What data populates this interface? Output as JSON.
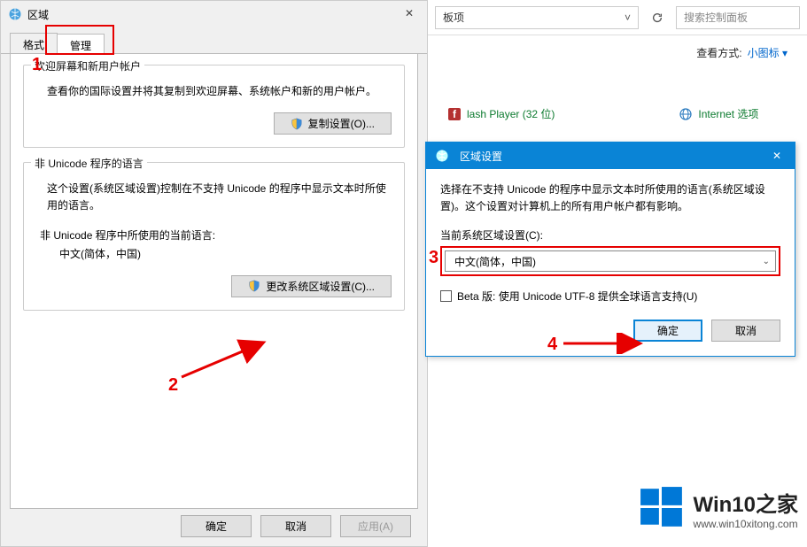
{
  "region_dialog": {
    "title": "区域",
    "tabs": {
      "format": "格式",
      "admin": "管理"
    },
    "welcome_group": {
      "title": "欢迎屏幕和新用户帐户",
      "desc": "查看你的国际设置并将其复制到欢迎屏幕、系统帐户和新的用户帐户。",
      "copy_btn": "复制设置(O)..."
    },
    "unicode_group": {
      "title": "非 Unicode 程序的语言",
      "desc": "这个设置(系统区域设置)控制在不支持 Unicode 的程序中显示文本时所使用的语言。",
      "current_label": "非 Unicode 程序中所使用的当前语言:",
      "current_value": "中文(简体，中国)",
      "change_btn": "更改系统区域设置(C)..."
    },
    "footer": {
      "ok": "确定",
      "cancel": "取消",
      "apply": "应用(A)"
    }
  },
  "control_panel": {
    "path_field": "板项",
    "search_placeholder": "搜索控制面板",
    "view_label": "查看方式:",
    "view_value": "小图标 ▾",
    "items": {
      "flash": "lash Player (32 位)",
      "internet": "Internet 选项"
    }
  },
  "modal": {
    "title": "区域设置",
    "desc": "选择在不支持 Unicode 的程序中显示文本时所使用的语言(系统区域设置)。这个设置对计算机上的所有用户帐户都有影响。",
    "combo_label": "当前系统区域设置(C):",
    "combo_value": "中文(简体，中国)",
    "beta_check": "Beta 版: 使用 Unicode UTF-8 提供全球语言支持(U)",
    "ok": "确定",
    "cancel": "取消"
  },
  "annotations": {
    "n1": "1",
    "n2": "2",
    "n3": "3",
    "n4": "4"
  },
  "watermark": {
    "big": "Win10之家",
    "small": "www.win10xitong.com"
  }
}
